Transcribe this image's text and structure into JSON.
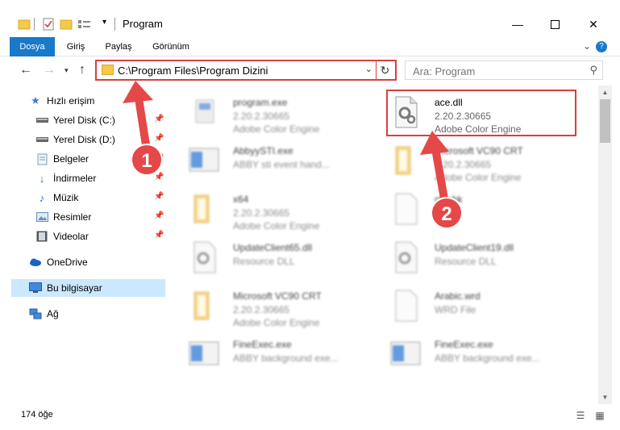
{
  "window": {
    "title": "Program",
    "minimize_icon": "minimize-icon",
    "maximize_icon": "maximize-icon",
    "close_icon": "close-icon"
  },
  "ribbon": {
    "tabs": [
      {
        "label": "Dosya"
      },
      {
        "label": "Giriş"
      },
      {
        "label": "Paylaş"
      },
      {
        "label": "Görünüm"
      }
    ]
  },
  "address": {
    "path": "C:\\Program Files\\Program Dizini",
    "search_placeholder": "Ara: Program"
  },
  "sidebar": {
    "items": [
      {
        "label": "Hızlı erişim",
        "icon": "star-icon"
      },
      {
        "label": "Yerel Disk (C:)",
        "icon": "drive-icon"
      },
      {
        "label": "Yerel Disk (D:)",
        "icon": "drive-icon"
      },
      {
        "label": "Belgeler",
        "icon": "documents-icon"
      },
      {
        "label": "İndirmeler",
        "icon": "downloads-icon"
      },
      {
        "label": "Müzik",
        "icon": "music-icon"
      },
      {
        "label": "Resimler",
        "icon": "pictures-icon"
      },
      {
        "label": "Videolar",
        "icon": "videos-icon"
      },
      {
        "label": "OneDrive",
        "icon": "cloud-icon"
      },
      {
        "label": "Bu bilgisayar",
        "icon": "computer-icon"
      },
      {
        "label": "Ağ",
        "icon": "network-icon"
      }
    ]
  },
  "files": [
    {
      "name": "program.exe",
      "version": "2.20.2.30665",
      "desc": "Adobe Color Engine",
      "icon": "exe-icon"
    },
    {
      "name": "ace.dll",
      "version": "2.20.2.30665",
      "desc": "Adobe Color Engine",
      "icon": "dll-icon"
    },
    {
      "name": "AbbyySTI.exe",
      "version": "ABBY sti event hand...",
      "desc": "",
      "icon": "app-window-icon"
    },
    {
      "name": "Microsoft VC90 CRT",
      "version": "2.20.2.30665",
      "desc": "Adobe Color Engine",
      "icon": "folder-icon"
    },
    {
      "name": "x64",
      "version": "2.20.2.30665",
      "desc": "Adobe Color Engine",
      "icon": "folder-icon"
    },
    {
      "name": "gfi.chk",
      "version": "",
      "desc": "",
      "icon": "blank-file-icon"
    },
    {
      "name": "UpdateClient65.dll",
      "version": "Resource DLL",
      "desc": "",
      "icon": "dll-icon"
    },
    {
      "name": "UpdateClient19.dll",
      "version": "Resource DLL",
      "desc": "",
      "icon": "dll-icon"
    },
    {
      "name": "Microsoft VC90 CRT",
      "version": "2.20.2.30665",
      "desc": "Adobe Color Engine",
      "icon": "folder-icon"
    },
    {
      "name": "Arabic.wrd",
      "version": "WRD File",
      "desc": "",
      "icon": "blank-file-icon"
    },
    {
      "name": "FineExec.exe",
      "version": "ABBY background exe...",
      "desc": "",
      "icon": "app-window-icon"
    },
    {
      "name": "FineExec.exe",
      "version": "ABBY background exe...",
      "desc": "",
      "icon": "app-window-icon"
    }
  ],
  "status": {
    "count": "174 öğe"
  },
  "annotations": {
    "step1": "1",
    "step2": "2",
    "color": "#d93f3f"
  }
}
